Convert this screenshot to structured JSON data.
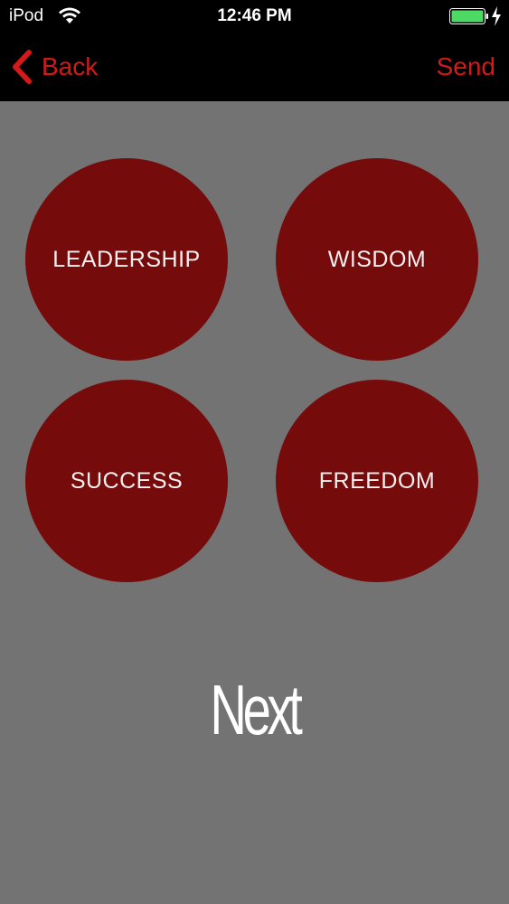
{
  "status_bar": {
    "carrier": "iPod",
    "time": "12:46 PM",
    "battery_color": "#4cd964"
  },
  "nav": {
    "back_label": "Back",
    "send_label": "Send",
    "accent_color": "#d21a1a"
  },
  "options": [
    {
      "label": "LEADERSHIP"
    },
    {
      "label": "WISDOM"
    },
    {
      "label": "SUCCESS"
    },
    {
      "label": "FREEDOM"
    }
  ],
  "next_label": "Next",
  "colors": {
    "background": "#747374",
    "circle": "#760b0b",
    "topbar": "#000000"
  }
}
